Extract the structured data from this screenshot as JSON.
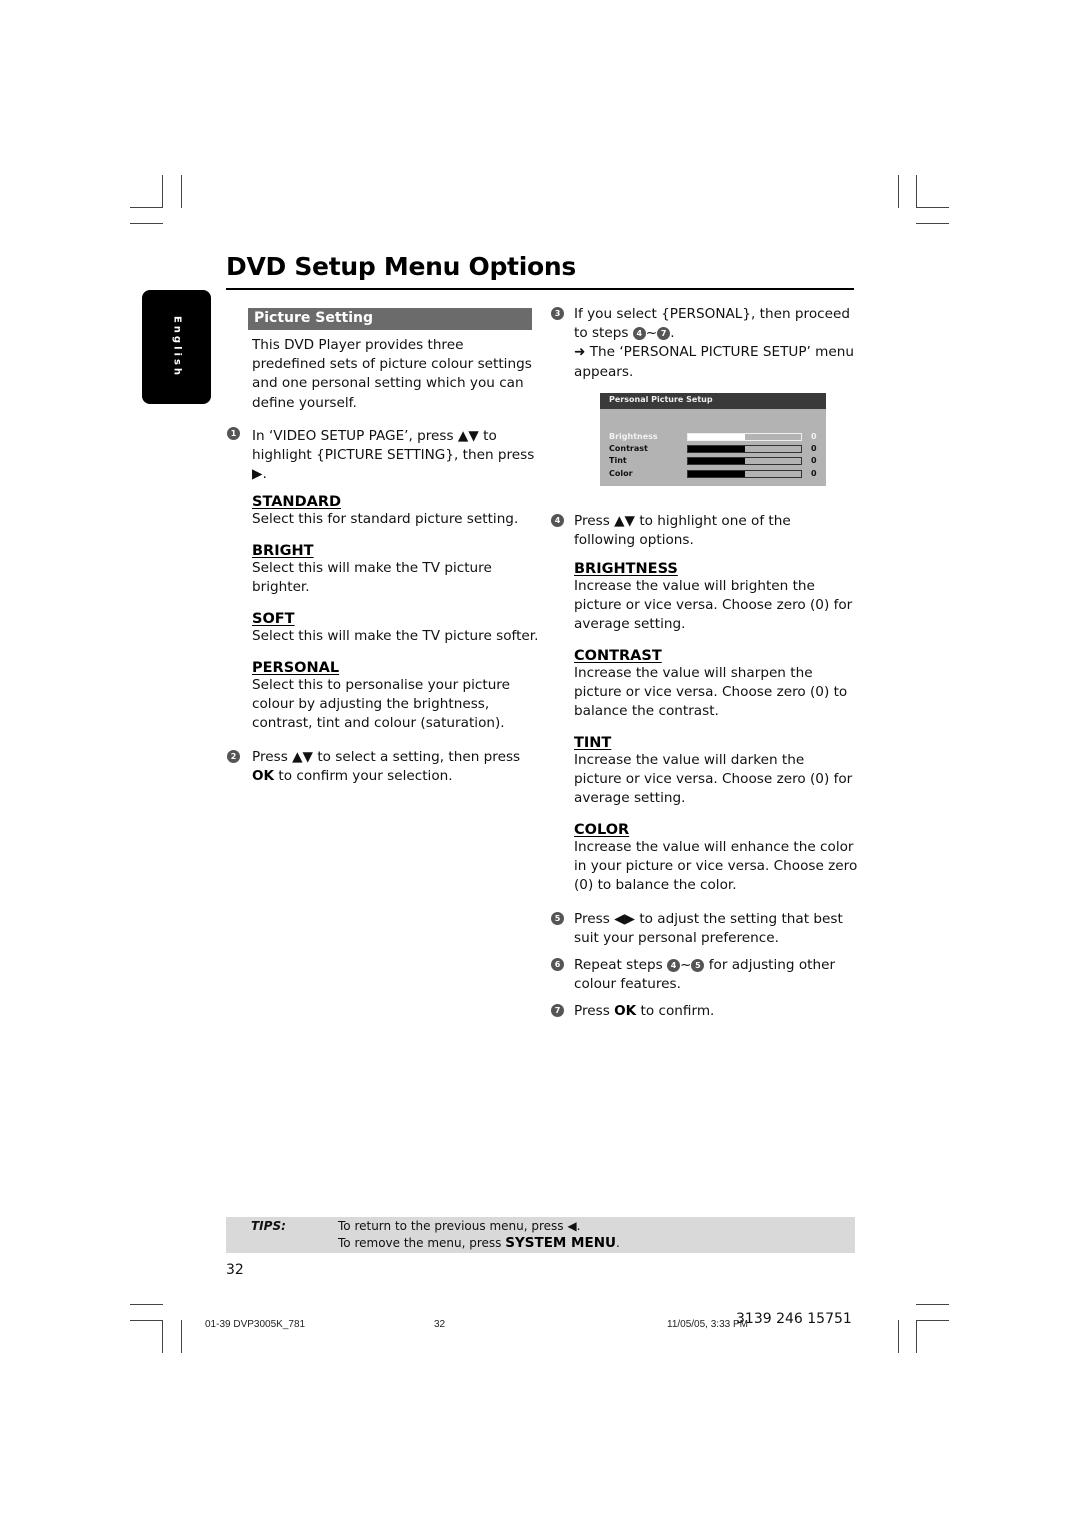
{
  "page": {
    "title": "DVD Setup Menu Options",
    "language_tab": "English",
    "page_number": "32"
  },
  "left_column": {
    "section_title": "Picture Setting",
    "intro": "This DVD Player provides three predefined sets of picture colour settings and one personal setting which you can define yourself.",
    "step1": {
      "num": "1",
      "text_a": "In ‘VIDEO SETUP PAGE’, press ▲▼ to highlight {PICTURE SETTING}, then press",
      "text_b": "▶."
    },
    "options": [
      {
        "heading": "STANDARD",
        "desc": "Select this for standard picture setting."
      },
      {
        "heading": "BRIGHT",
        "desc": "Select this will make the TV picture brighter."
      },
      {
        "heading": "SOFT",
        "desc": "Select this will make the TV picture softer."
      },
      {
        "heading": "PERSONAL",
        "desc": "Select this to personalise your picture colour by adjusting the brightness, contrast, tint and colour (saturation)."
      }
    ],
    "step2": {
      "num": "2",
      "text_a": "Press ▲▼ to select a setting, then press",
      "ok": "OK",
      "text_b": "to confirm your selection."
    }
  },
  "right_column": {
    "step3": {
      "num": "3",
      "text_a": "If you select {PERSONAL}, then proceed to steps",
      "ref_from": "4",
      "tilde": "~",
      "ref_to": "7",
      "period": ".",
      "result": "➜ The ‘PERSONAL PICTURE SETUP’ menu appears."
    },
    "osd_menu": {
      "title": "Personal Picture Setup",
      "rows": [
        {
          "label": "Brightness",
          "value": "0",
          "level": 0.5,
          "selected": true
        },
        {
          "label": "Contrast",
          "value": "0",
          "level": 0.5,
          "selected": false
        },
        {
          "label": "Tint",
          "value": "0",
          "level": 0.5,
          "selected": false
        },
        {
          "label": "Color",
          "value": "0",
          "level": 0.5,
          "selected": false
        }
      ]
    },
    "step4": {
      "num": "4",
      "text": "Press ▲▼ to highlight one of the following options."
    },
    "options": [
      {
        "heading": "BRIGHTNESS",
        "desc": "Increase the value will brighten the picture or vice versa. Choose zero (0) for average setting."
      },
      {
        "heading": "CONTRAST",
        "desc": "Increase the value will sharpen the picture or vice versa.  Choose zero (0) to balance the contrast."
      },
      {
        "heading": "TINT",
        "desc": "Increase the value will darken the picture or vice versa.  Choose zero (0) for average setting."
      },
      {
        "heading": "COLOR",
        "desc": "Increase the value will enhance the color in your picture or vice versa. Choose zero (0) to balance the color."
      }
    ],
    "step5": {
      "num": "5",
      "text": "Press ◀▶ to adjust the setting that best suit your personal preference."
    },
    "step6": {
      "num": "6",
      "text_a": "Repeat steps",
      "ref_from": "4",
      "tilde": "~",
      "ref_to": "5",
      "text_b": "for adjusting other colour features."
    },
    "step7": {
      "num": "7",
      "text_a": "Press",
      "ok": "OK",
      "text_b": "to confirm."
    }
  },
  "tips": {
    "label": "TIPS:",
    "line1": "To return to the previous menu, press ◀.",
    "line2_a": "To remove the menu, press",
    "line2_key": "SYSTEM MENU",
    "line2_b": "."
  },
  "print_footer": {
    "file": "01-39 DVP3005K_781",
    "page": "32",
    "datetime": "11/05/05, 3:33 PM",
    "code": "3139 246 15751"
  }
}
